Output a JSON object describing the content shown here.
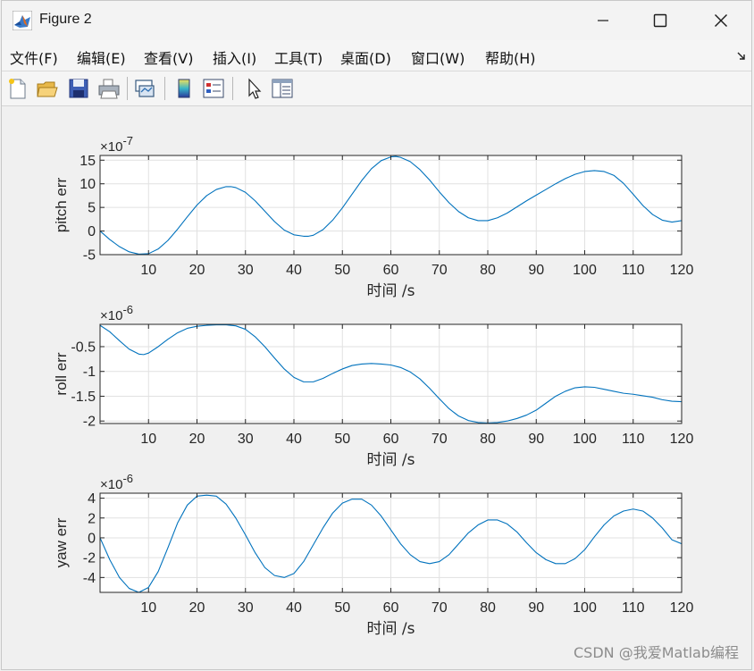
{
  "window": {
    "title": "Figure 2",
    "controls": {
      "minimize": "minimize",
      "maximize": "maximize",
      "close": "close"
    }
  },
  "menu": [
    "文件(F)",
    "编辑(E)",
    "查看(V)",
    "插入(I)",
    "工具(T)",
    "桌面(D)",
    "窗口(W)",
    "帮助(H)"
  ],
  "toolbar": {
    "buttons": [
      "new-figure-icon",
      "open-file-icon",
      "save-icon",
      "print-icon",
      "link-plot-icon",
      "colorbar-icon",
      "legend-icon",
      "pointer-icon",
      "property-inspector-icon"
    ]
  },
  "watermark": "CSDN @我爱Matlab编程",
  "chart_data": [
    {
      "type": "line",
      "ylabel": "pitch err",
      "xlabel": "时间 /s",
      "exponent": "×10^-7",
      "exp_base": "×10",
      "exp_power": "-7",
      "xlim": [
        0,
        120
      ],
      "ylim": [
        -5,
        16
      ],
      "xticks": [
        10,
        20,
        30,
        40,
        50,
        60,
        70,
        80,
        90,
        100,
        110,
        120
      ],
      "yticks": [
        -5,
        0,
        5,
        10,
        15
      ],
      "ytick_labels": [
        "-5",
        "0",
        "5",
        "10",
        "15"
      ],
      "grid": true,
      "color": "#0072BD",
      "series": [
        {
          "x": [
            0,
            2,
            4,
            6,
            8,
            10,
            12,
            14,
            16,
            18,
            20,
            22,
            24,
            26,
            27,
            28,
            30,
            32,
            34,
            36,
            38,
            40,
            42,
            43,
            44,
            46,
            48,
            50,
            52,
            54,
            56,
            58,
            60,
            61,
            62,
            64,
            66,
            68,
            70,
            72,
            74,
            76,
            78,
            80,
            82,
            84,
            86,
            88,
            90,
            92,
            94,
            96,
            98,
            100,
            102,
            104,
            106,
            108,
            110,
            112,
            114,
            116,
            118,
            120
          ],
          "y": [
            0,
            -1.8,
            -3.3,
            -4.4,
            -4.9,
            -4.8,
            -3.8,
            -2.0,
            0.4,
            3.0,
            5.5,
            7.5,
            8.8,
            9.4,
            9.4,
            9.2,
            8.2,
            6.4,
            4.2,
            2.0,
            0.2,
            -0.8,
            -1.1,
            -1.1,
            -0.9,
            0.3,
            2.3,
            4.9,
            7.8,
            10.7,
            13.2,
            14.9,
            15.7,
            15.8,
            15.6,
            14.7,
            13.0,
            10.8,
            8.3,
            6.0,
            4.1,
            2.8,
            2.2,
            2.2,
            2.8,
            3.8,
            5.1,
            6.4,
            7.6,
            8.8,
            10.0,
            11.1,
            12.0,
            12.6,
            12.8,
            12.6,
            11.8,
            10.1,
            7.8,
            5.4,
            3.5,
            2.3,
            1.9,
            2.2
          ]
        }
      ]
    },
    {
      "type": "line",
      "ylabel": "roll err",
      "xlabel": "时间 /s",
      "exponent": "×10^-6",
      "exp_base": "×10",
      "exp_power": "-6",
      "xlim": [
        0,
        120
      ],
      "ylim": [
        -2.05,
        -0.05
      ],
      "xticks": [
        10,
        20,
        30,
        40,
        50,
        60,
        70,
        80,
        90,
        100,
        110,
        120
      ],
      "yticks": [
        -2,
        -1.5,
        -1,
        -0.5
      ],
      "ytick_labels": [
        "-2",
        "-1.5",
        "-1",
        "-0.5"
      ],
      "grid": true,
      "color": "#0072BD",
      "series": [
        {
          "x": [
            0,
            2,
            4,
            6,
            8,
            9,
            10,
            12,
            14,
            16,
            18,
            20,
            22,
            24,
            26,
            28,
            30,
            32,
            34,
            36,
            38,
            40,
            42,
            44,
            46,
            48,
            50,
            52,
            54,
            56,
            58,
            60,
            62,
            64,
            66,
            68,
            70,
            72,
            74,
            76,
            78,
            80,
            82,
            84,
            86,
            88,
            90,
            92,
            94,
            96,
            98,
            100,
            102,
            104,
            106,
            108,
            110,
            112,
            114,
            116,
            118,
            120
          ],
          "y": [
            -0.07,
            -0.2,
            -0.38,
            -0.55,
            -0.65,
            -0.66,
            -0.63,
            -0.5,
            -0.35,
            -0.22,
            -0.13,
            -0.09,
            -0.07,
            -0.06,
            -0.06,
            -0.08,
            -0.15,
            -0.3,
            -0.5,
            -0.73,
            -0.95,
            -1.12,
            -1.21,
            -1.21,
            -1.14,
            -1.04,
            -0.95,
            -0.88,
            -0.85,
            -0.84,
            -0.85,
            -0.87,
            -0.92,
            -1.01,
            -1.15,
            -1.34,
            -1.55,
            -1.75,
            -1.9,
            -1.99,
            -2.03,
            -2.04,
            -2.03,
            -2.0,
            -1.95,
            -1.88,
            -1.78,
            -1.64,
            -1.5,
            -1.4,
            -1.33,
            -1.31,
            -1.32,
            -1.36,
            -1.4,
            -1.44,
            -1.46,
            -1.49,
            -1.52,
            -1.57,
            -1.6,
            -1.61
          ]
        }
      ]
    },
    {
      "type": "line",
      "ylabel": "yaw err",
      "xlabel": "时间 /s",
      "exponent": "×10^-6",
      "exp_base": "×10",
      "exp_power": "-6",
      "xlim": [
        0,
        120
      ],
      "ylim": [
        -5.5,
        4.5
      ],
      "xticks": [
        10,
        20,
        30,
        40,
        50,
        60,
        70,
        80,
        90,
        100,
        110,
        120
      ],
      "yticks": [
        -4,
        -2,
        0,
        2,
        4
      ],
      "ytick_labels": [
        "-4",
        "-2",
        "0",
        "2",
        "4"
      ],
      "grid": true,
      "color": "#0072BD",
      "series": [
        {
          "x": [
            0,
            2,
            4,
            6,
            8,
            10,
            12,
            14,
            16,
            18,
            20,
            22,
            24,
            26,
            28,
            30,
            32,
            34,
            36,
            38,
            40,
            42,
            44,
            46,
            48,
            50,
            52,
            54,
            56,
            58,
            60,
            62,
            64,
            66,
            68,
            70,
            72,
            74,
            76,
            78,
            80,
            82,
            84,
            86,
            88,
            90,
            92,
            94,
            96,
            98,
            100,
            102,
            104,
            106,
            108,
            110,
            112,
            114,
            116,
            118,
            120
          ],
          "y": [
            0,
            -2.2,
            -4.0,
            -5.1,
            -5.5,
            -5.0,
            -3.4,
            -1.0,
            1.5,
            3.3,
            4.2,
            4.3,
            4.2,
            3.4,
            2.0,
            0.3,
            -1.5,
            -3.0,
            -3.8,
            -4.0,
            -3.6,
            -2.4,
            -0.7,
            1.0,
            2.5,
            3.5,
            3.9,
            3.9,
            3.3,
            2.2,
            0.8,
            -0.6,
            -1.7,
            -2.4,
            -2.6,
            -2.4,
            -1.7,
            -0.6,
            0.5,
            1.3,
            1.8,
            1.8,
            1.4,
            0.6,
            -0.5,
            -1.5,
            -2.2,
            -2.6,
            -2.6,
            -2.1,
            -1.2,
            0.1,
            1.3,
            2.2,
            2.7,
            2.9,
            2.7,
            2.0,
            1.0,
            -0.2,
            -0.6
          ]
        }
      ]
    }
  ]
}
